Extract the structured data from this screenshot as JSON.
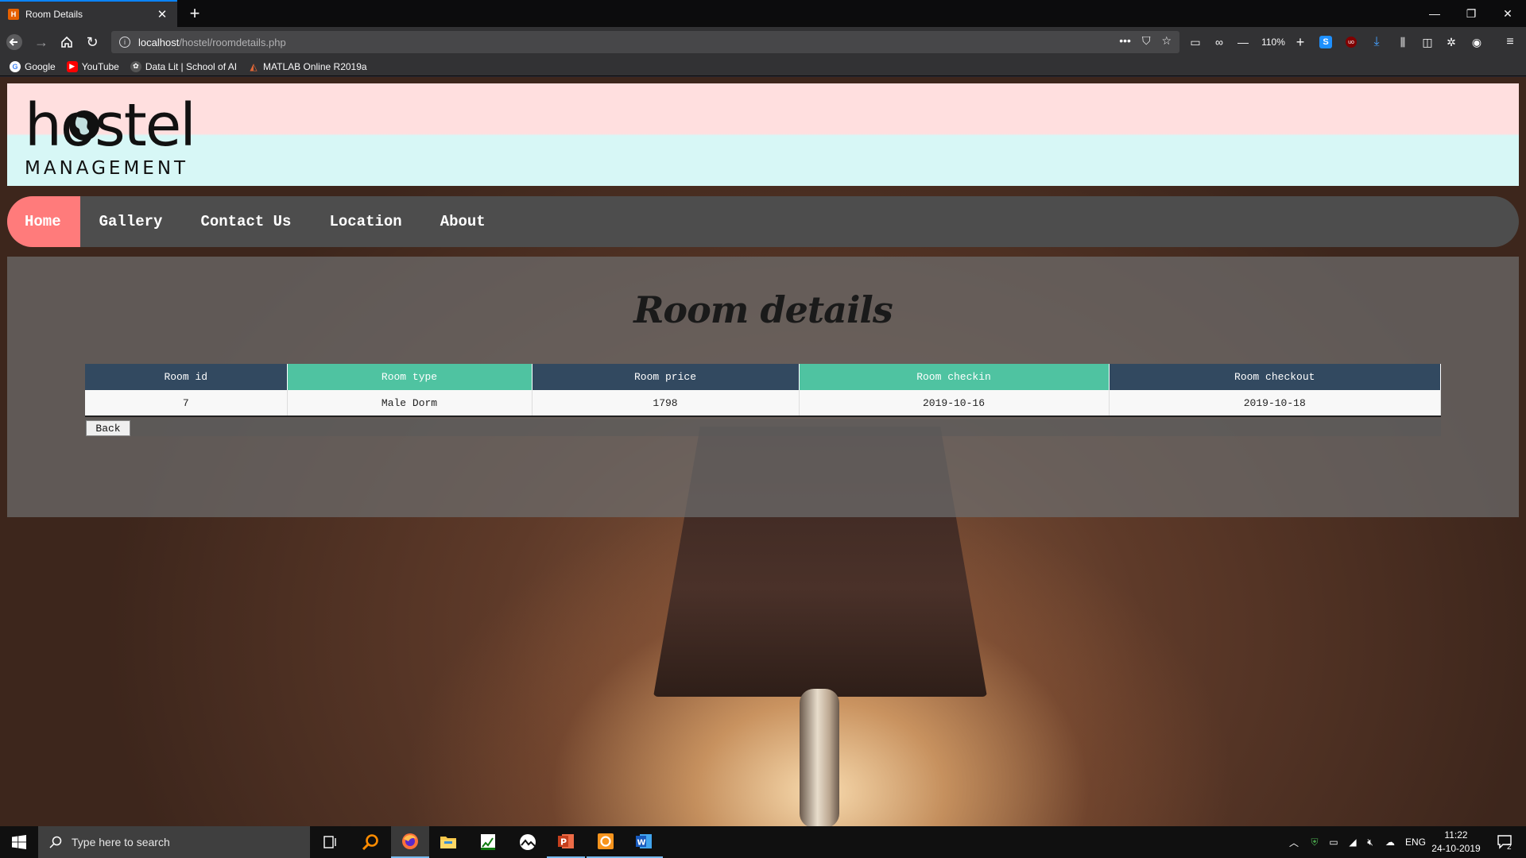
{
  "browser": {
    "tab_title": "Room Details",
    "tab_favicon": "hostel-favicon",
    "url_host": "localhost",
    "url_path": "/hostel/roomdetails.php",
    "zoom": "110%",
    "bookmarks": [
      {
        "label": "Google",
        "icon": "google-icon"
      },
      {
        "label": "YouTube",
        "icon": "youtube-icon"
      },
      {
        "label": "Data Lit | School of AI",
        "icon": "data-lit-icon"
      },
      {
        "label": "MATLAB Online R2019a",
        "icon": "matlab-icon"
      }
    ]
  },
  "site": {
    "logo": {
      "main": "hostel",
      "sub": "MANAGEMENT"
    },
    "menu": [
      "Home",
      "Gallery",
      "Contact Us",
      "Location",
      "About"
    ],
    "heading": "Room details",
    "table": {
      "headers": [
        "Room id",
        "Room type",
        "Room price",
        "Room checkin",
        "Room checkout"
      ],
      "rows": [
        [
          "7",
          "Male Dorm",
          "1798",
          "2019-10-16",
          "2019-10-18"
        ]
      ]
    },
    "back_label": "Back"
  },
  "colors": {
    "menu_active": "#ff7b7b",
    "menu_bg": "#4d4d4d",
    "header_dark": "#324960",
    "header_teal": "#4fc3a1",
    "logo_top_band": "#ffdfdf",
    "logo_bottom_band": "#d7f7f6"
  },
  "taskbar": {
    "search_placeholder": "Type here to search",
    "language": "ENG",
    "time": "11:22",
    "date": "24-10-2019",
    "notifications": "2"
  }
}
